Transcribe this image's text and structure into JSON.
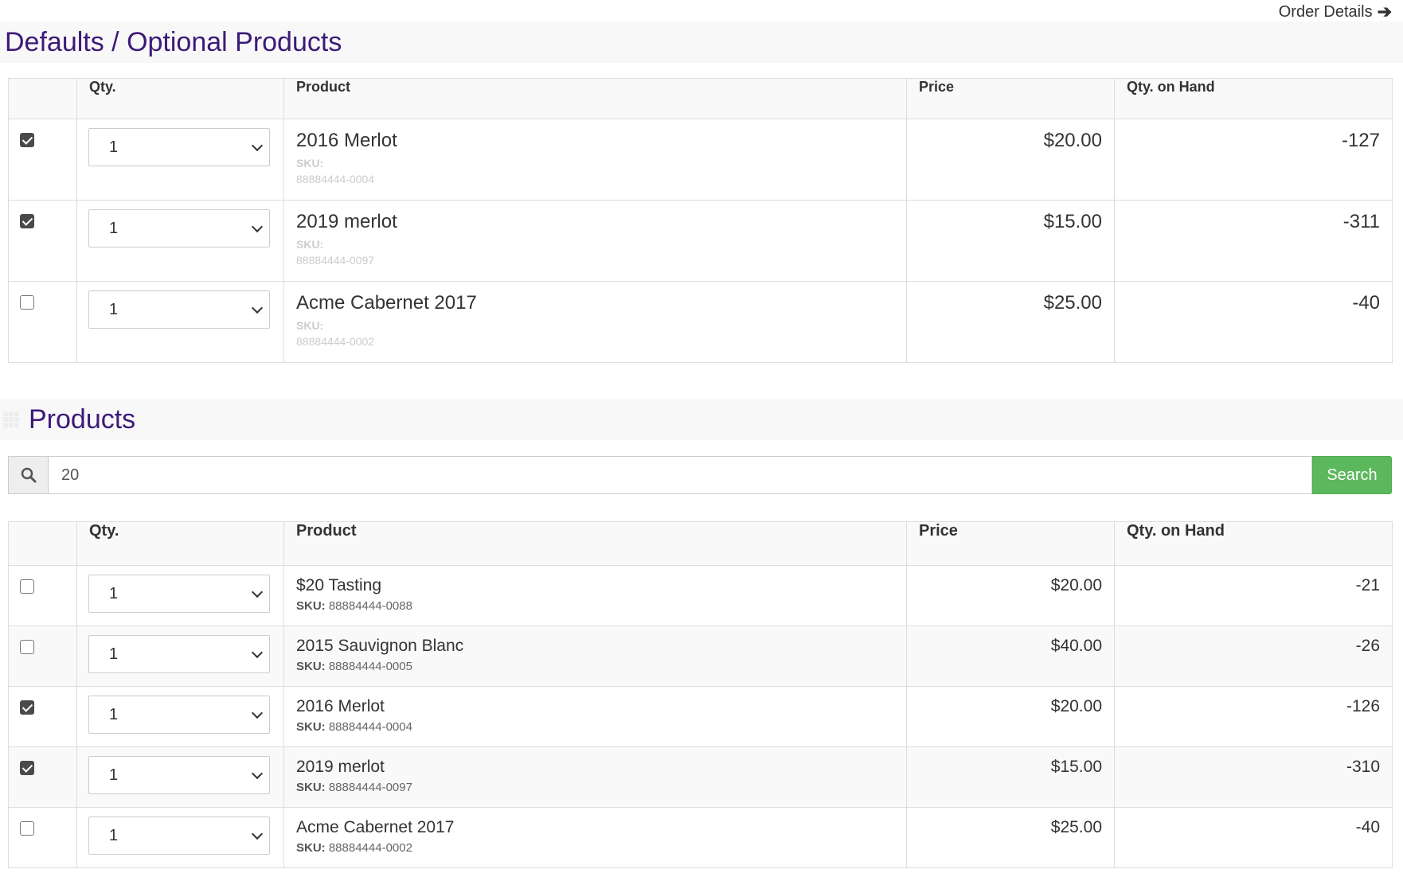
{
  "header": {
    "order_details_label": "Order Details",
    "arrow_icon": "arrow-right-icon"
  },
  "defaults_section": {
    "title": "Defaults / Optional Products",
    "columns": [
      "",
      "Qty.",
      "Product",
      "Price",
      "Qty. on Hand"
    ],
    "rows": [
      {
        "checked": true,
        "qty": "1",
        "name": "2016 Merlot",
        "sku_label": "SKU:",
        "sku": "88884444-0004",
        "price": "$20.00",
        "on_hand": "-127"
      },
      {
        "checked": true,
        "qty": "1",
        "name": "2019 merlot",
        "sku_label": "SKU:",
        "sku": "88884444-0097",
        "price": "$15.00",
        "on_hand": "-311"
      },
      {
        "checked": false,
        "qty": "1",
        "name": "Acme Cabernet 2017",
        "sku_label": "SKU:",
        "sku": "88884444-0002",
        "price": "$25.00",
        "on_hand": "-40"
      }
    ]
  },
  "products_section": {
    "title": "Products",
    "search": {
      "value": "20",
      "button_label": "Search"
    },
    "columns": [
      "",
      "Qty.",
      "Product",
      "Price",
      "Qty. on Hand"
    ],
    "rows": [
      {
        "checked": false,
        "qty": "1",
        "name": "$20 Tasting",
        "sku_label": "SKU:",
        "sku": "88884444-0088",
        "price": "$20.00",
        "on_hand": "-21"
      },
      {
        "checked": false,
        "qty": "1",
        "name": "2015 Sauvignon Blanc",
        "sku_label": "SKU:",
        "sku": "88884444-0005",
        "price": "$40.00",
        "on_hand": "-26"
      },
      {
        "checked": true,
        "qty": "1",
        "name": "2016 Merlot",
        "sku_label": "SKU:",
        "sku": "88884444-0004",
        "price": "$20.00",
        "on_hand": "-126"
      },
      {
        "checked": true,
        "qty": "1",
        "name": "2019 merlot",
        "sku_label": "SKU:",
        "sku": "88884444-0097",
        "price": "$15.00",
        "on_hand": "-310"
      },
      {
        "checked": false,
        "qty": "1",
        "name": "Acme Cabernet 2017",
        "sku_label": "SKU:",
        "sku": "88884444-0002",
        "price": "$25.00",
        "on_hand": "-40"
      }
    ]
  },
  "colors": {
    "title": "#3c1a78",
    "search_button": "#5cb85c",
    "header_bg": "#f8f8f8"
  }
}
